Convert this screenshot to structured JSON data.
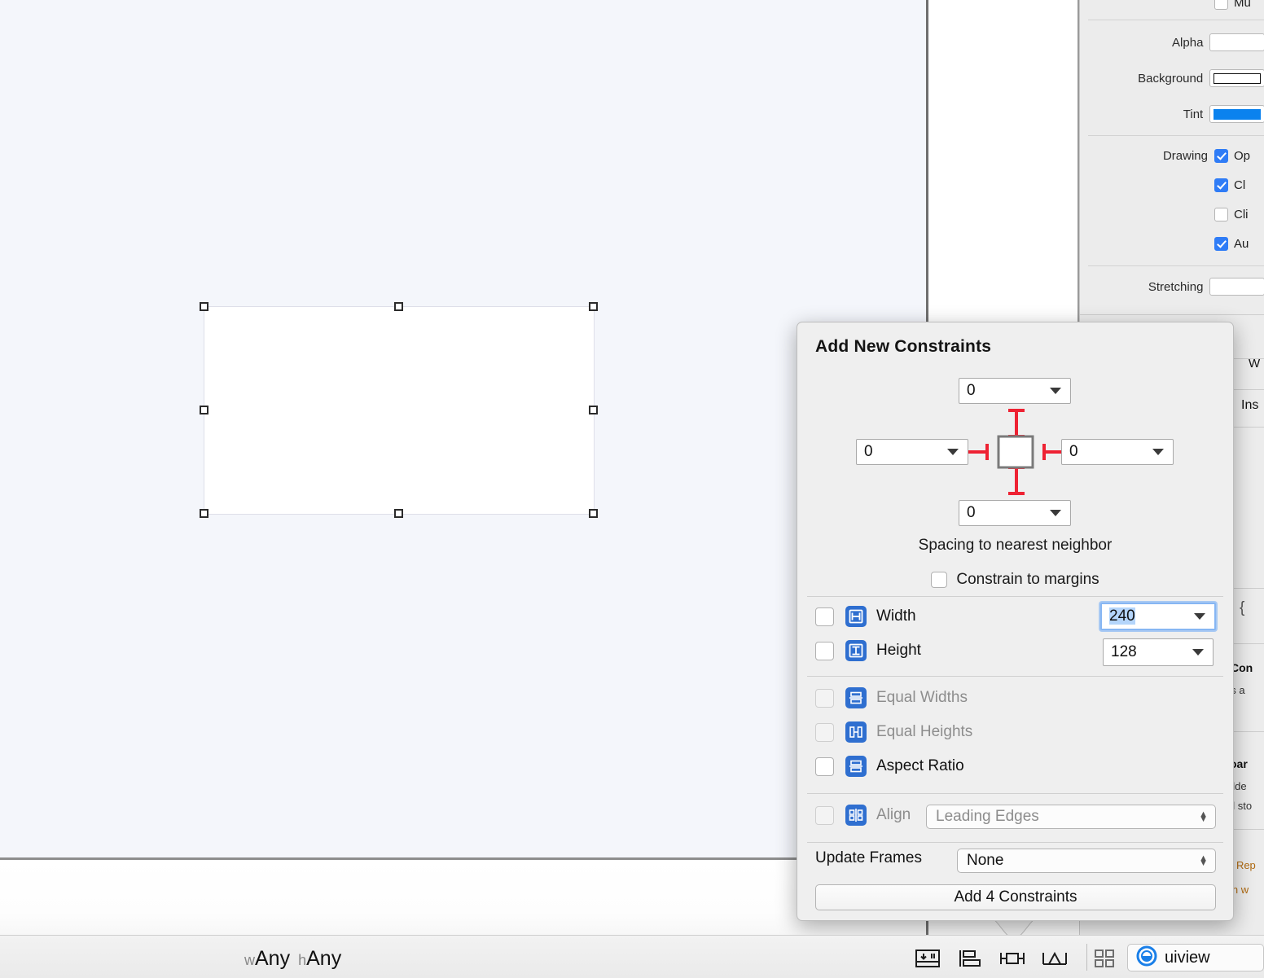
{
  "canvas": {
    "selected_object_name": "uiview"
  },
  "inspector": {
    "rows": [
      {
        "label": "",
        "type": "checkbox-cut",
        "text": "Mu",
        "checked": false
      },
      {
        "label": "Alpha",
        "type": "field",
        "value": ""
      },
      {
        "label": "Background",
        "type": "swatch",
        "color": "#ffffff"
      },
      {
        "label": "Tint",
        "type": "swatch",
        "color": "#0b82ee"
      },
      {
        "label": "Drawing",
        "type": "checkbox-cut",
        "text": "Op",
        "checked": true
      },
      {
        "label": "",
        "type": "checkbox-cut",
        "text": "Cl",
        "checked": true
      },
      {
        "label": "",
        "type": "checkbox-cut",
        "text": "Cli",
        "checked": false
      },
      {
        "label": "",
        "type": "checkbox-cut",
        "text": "Au",
        "checked": true
      },
      {
        "label": "Stretching",
        "type": "field",
        "value": ""
      }
    ],
    "library": {
      "cut_rows": [
        "W",
        "Ins"
      ],
      "items": [
        {
          "title": "Con",
          "sub": "es a"
        },
        {
          "title": "oar",
          "sub": "olde",
          "sub2": "al sto"
        },
        {
          "title": "",
          "sub": "- Rep",
          "sub2": "in w"
        }
      ]
    }
  },
  "popover": {
    "title": "Add New Constraints",
    "spacing": {
      "top": "0",
      "left": "0",
      "right": "0",
      "bottom": "0",
      "caption": "Spacing to nearest neighbor",
      "constrain_to_margins_label": "Constrain to margins",
      "constrain_to_margins_checked": false
    },
    "options": [
      {
        "name": "width",
        "label": "Width",
        "checked": false,
        "dim": false,
        "icon": "width-constraint-icon",
        "value": "240",
        "focused": true
      },
      {
        "name": "height",
        "label": "Height",
        "checked": false,
        "dim": false,
        "icon": "height-constraint-icon",
        "value": "128",
        "focused": false
      },
      {
        "name": "equal-widths",
        "label": "Equal Widths",
        "checked": false,
        "dim": true,
        "icon": "equal-widths-icon",
        "value": null,
        "focused": false
      },
      {
        "name": "equal-heights",
        "label": "Equal Heights",
        "checked": false,
        "dim": true,
        "icon": "equal-heights-icon",
        "value": null,
        "focused": false
      },
      {
        "name": "aspect-ratio",
        "label": "Aspect Ratio",
        "checked": false,
        "dim": false,
        "icon": "aspect-ratio-icon",
        "value": null,
        "focused": false
      }
    ],
    "align": {
      "label": "Align",
      "checked": false,
      "selected_option": "Leading Edges"
    },
    "update_frames": {
      "label": "Update Frames",
      "selected_option": "None"
    },
    "add_button_label": "Add 4 Constraints"
  },
  "bottom_bar": {
    "size_class": {
      "w_prefix": "w",
      "w_value": "Any",
      "h_prefix": "h",
      "h_value": "Any"
    },
    "tools": [
      {
        "name": "update-frames-icon"
      },
      {
        "name": "align-icon"
      },
      {
        "name": "pin-icon"
      },
      {
        "name": "resolve-auto-layout-issues-icon"
      },
      {
        "name": "editor-layout-icon"
      }
    ],
    "jump_bar": {
      "label": "uiview",
      "icon": "uiview-object-icon"
    }
  },
  "colors": {
    "canvas": "#f4f6fb",
    "accent_blue": "#2f7cf6",
    "constraint_red": "#ee2233",
    "icon_blue": "#2f6fd0"
  }
}
